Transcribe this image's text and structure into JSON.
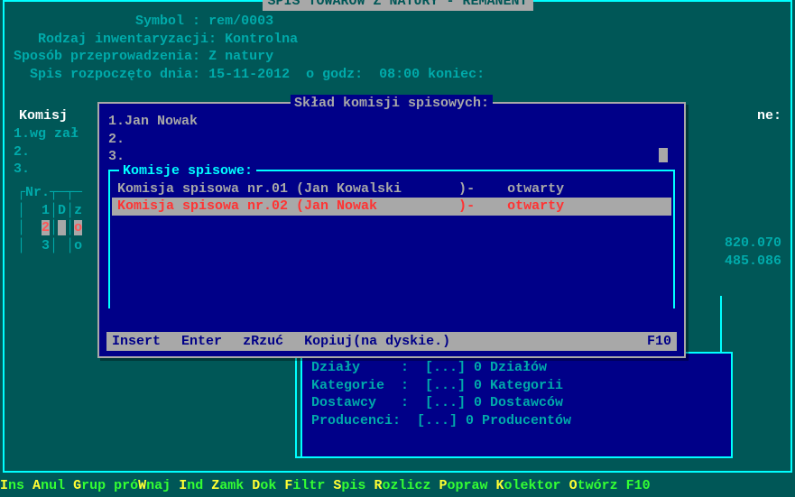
{
  "title": " SPIS TOWARÓW Z NATURY - REMANENT ",
  "header": {
    "symbol_lbl": "Symbol :",
    "symbol_val": "rem/0003",
    "kind_lbl": "Rodzaj inwentaryzacji:",
    "kind_val": "Kontrolna",
    "method_lbl": "Sposób przeprowadzenia:",
    "method_val": "Z natury",
    "start_lbl": "Spis rozpoczęto dnia:",
    "start_date": "15-11-2012",
    "o_godz": "o godz:",
    "start_time": "08:00",
    "koniec": "koniec:"
  },
  "komisja_lbl": "Komisj",
  "obecne_lbl": "ne:",
  "left_list": [
    "1.wg zał",
    "2.",
    "3."
  ],
  "bg_table": {
    "hdr": "Nr.",
    "rows": [
      {
        "nr": "1",
        "a": "D",
        "b": "z"
      },
      {
        "nr": "2",
        "a": " ",
        "b": "o",
        "sel": true
      },
      {
        "nr": "3",
        "a": " ",
        "b": "o"
      }
    ]
  },
  "right_nums": [
    "820.070",
    "485.086"
  ],
  "dialog": {
    "title": " Skład komisji spisowych: ",
    "members": [
      "1.Jan Nowak",
      "2.",
      "3."
    ],
    "inner_title": "Komisje spisowe:",
    "komisje": [
      {
        "txt": "Komisja spisowa nr.01 (Jan Kowalski       )-    otwarty",
        "sel": false
      },
      {
        "txt": "Komisja spisowa nr.02 (Jan Nowak          )-    otwarty",
        "sel": true
      }
    ],
    "footer": {
      "insert": "Insert",
      "enter": "Enter",
      "zrzuc": "zRzuć",
      "kopiuj": "Kopiuj(na dyskie.)",
      "f10": "F10"
    }
  },
  "subpanel": {
    "rows": [
      {
        "k": "Działy    ",
        "v": "[...] 0 Działów"
      },
      {
        "k": "Kategorie ",
        "v": "[...] 0 Kategorii"
      },
      {
        "k": "Dostawcy  ",
        "v": "[...] 0 Dostawców"
      },
      {
        "k": "Producenci",
        "v": "[...] 0 Producentów"
      }
    ]
  },
  "bottom": {
    "items": [
      "Ins",
      "Anul",
      "Grup",
      "próWnaj",
      "Ind",
      "Zamk",
      "Dok",
      "Filtr",
      "Spis",
      "Rozlicz",
      "Popraw",
      "Kolektor",
      "Otwórz",
      "F10"
    ],
    "hot": [
      "I",
      "A",
      "G",
      "W",
      "I",
      "Z",
      "D",
      "F",
      "S",
      "R",
      "P",
      "K",
      "O",
      ""
    ]
  }
}
